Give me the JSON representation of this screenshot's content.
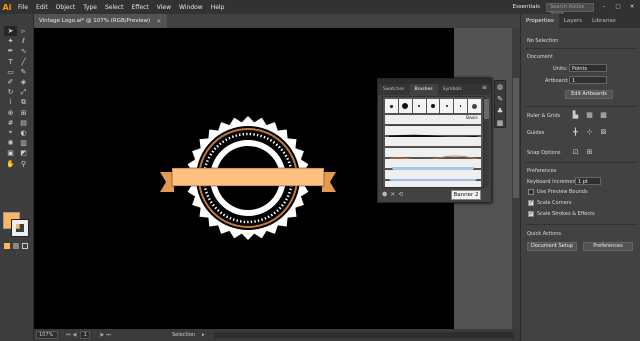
{
  "app": {
    "logo": "Ai"
  },
  "menu": [
    "File",
    "Edit",
    "Object",
    "Type",
    "Select",
    "Effect",
    "View",
    "Window",
    "Help"
  ],
  "menu_right": {
    "workspace": "Essentials",
    "search_placeholder": "Search Adobe Stock"
  },
  "document_tab": {
    "title": "Vintage Logo.ai* @ 107% (RGB/Preview)",
    "close": "×"
  },
  "status": {
    "zoom": "107%",
    "page": "1",
    "selection": "Selection"
  },
  "right_panel": {
    "tabs": [
      "Properties",
      "Layers",
      "Libraries"
    ],
    "no_selection": "No Selection",
    "document_label": "Document",
    "units_label": "Units:",
    "units_value": "Points",
    "artboard_label": "Artboard:",
    "artboard_value": "1",
    "edit_artboards": "Edit Artboards",
    "rulers_grids": "Ruler & Grids",
    "guides": "Guides",
    "snap_options": "Snap Options",
    "preferences_label": "Preferences",
    "keyboard_increment_label": "Keyboard Increment:",
    "keyboard_increment_value": "1 pt",
    "use_preview_bounds": "Use Preview Bounds",
    "scale_corners": "Scale Corners",
    "scale_strokes": "Scale Strokes & Effects",
    "quick_actions": "Quick Actions",
    "document_setup": "Document Setup",
    "preferences_btn": "Preferences"
  },
  "brushes_panel": {
    "tabs": [
      "Swatches",
      "Brushes",
      "Symbols"
    ],
    "basic_label": "Basic",
    "tooltip": "Banner 2"
  },
  "colors": {
    "fill": "#fdb560",
    "accent": "#ff9a00",
    "canvas": "#000000"
  }
}
